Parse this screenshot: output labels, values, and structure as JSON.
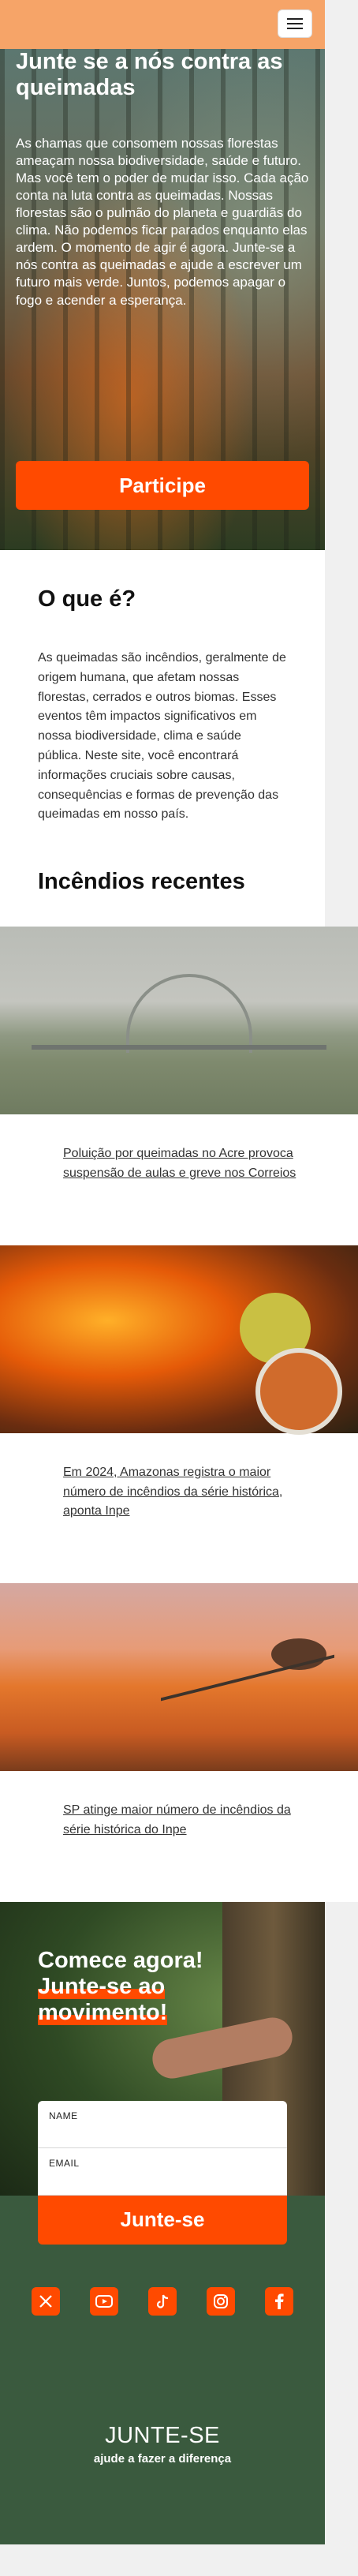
{
  "header": {
    "menu_label": ""
  },
  "hero": {
    "title": "Junte se a nós contra as queimadas",
    "text": "As chamas que consomem nossas florestas ameaçam nossa biodiversidade, saúde e futuro. Mas você tem o poder de mudar isso. Cada ação conta na luta contra as queimadas. Nossas florestas são o pulmão do planeta e guardiãs do clima. Não podemos ficar parados enquanto elas ardem. O momento de agir é agora. Junte-se a nós contra as queimadas e ajude a escrever um futuro mais verde. Juntos, podemos apagar o fogo e acender a esperança.",
    "cta": "Participe"
  },
  "about": {
    "title": "O que é?",
    "text": "As queimadas são incêndios, geralmente de origem humana, que afetam nossas florestas, cerrados e outros biomas. Esses eventos têm impactos significativos em nossa biodiversidade, clima e saúde pública. Neste site, você encontrará informações cruciais sobre causas, consequências e formas de prevenção das queimadas em nosso país."
  },
  "recent": {
    "title": "Incêndios recentes",
    "items": [
      {
        "caption": "Poluição por queimadas no Acre provoca suspensão de aulas e greve nos Correios"
      },
      {
        "caption": "Em 2024, Amazonas registra o maior número de incêndios da série histórica, aponta Inpe"
      },
      {
        "caption": "SP atinge maior número de incêndios da série histórica do Inpe"
      }
    ]
  },
  "join": {
    "title_line1": "Comece agora!",
    "title_line2": "Junte-se ao",
    "title_line3": "movimento!",
    "name_label": "NAME",
    "email_label": "EMAIL",
    "name_value": "",
    "email_value": "",
    "cta": "Junte-se"
  },
  "footer": {
    "social": [
      "x-icon",
      "youtube-icon",
      "tiktok-icon",
      "instagram-icon",
      "facebook-icon"
    ],
    "brand": "JUNTE-SE",
    "tagline": "ajude a fazer a diferença"
  },
  "colors": {
    "accent": "#ff4a00",
    "header": "#f6a468",
    "footer": "#3a5a3e"
  }
}
